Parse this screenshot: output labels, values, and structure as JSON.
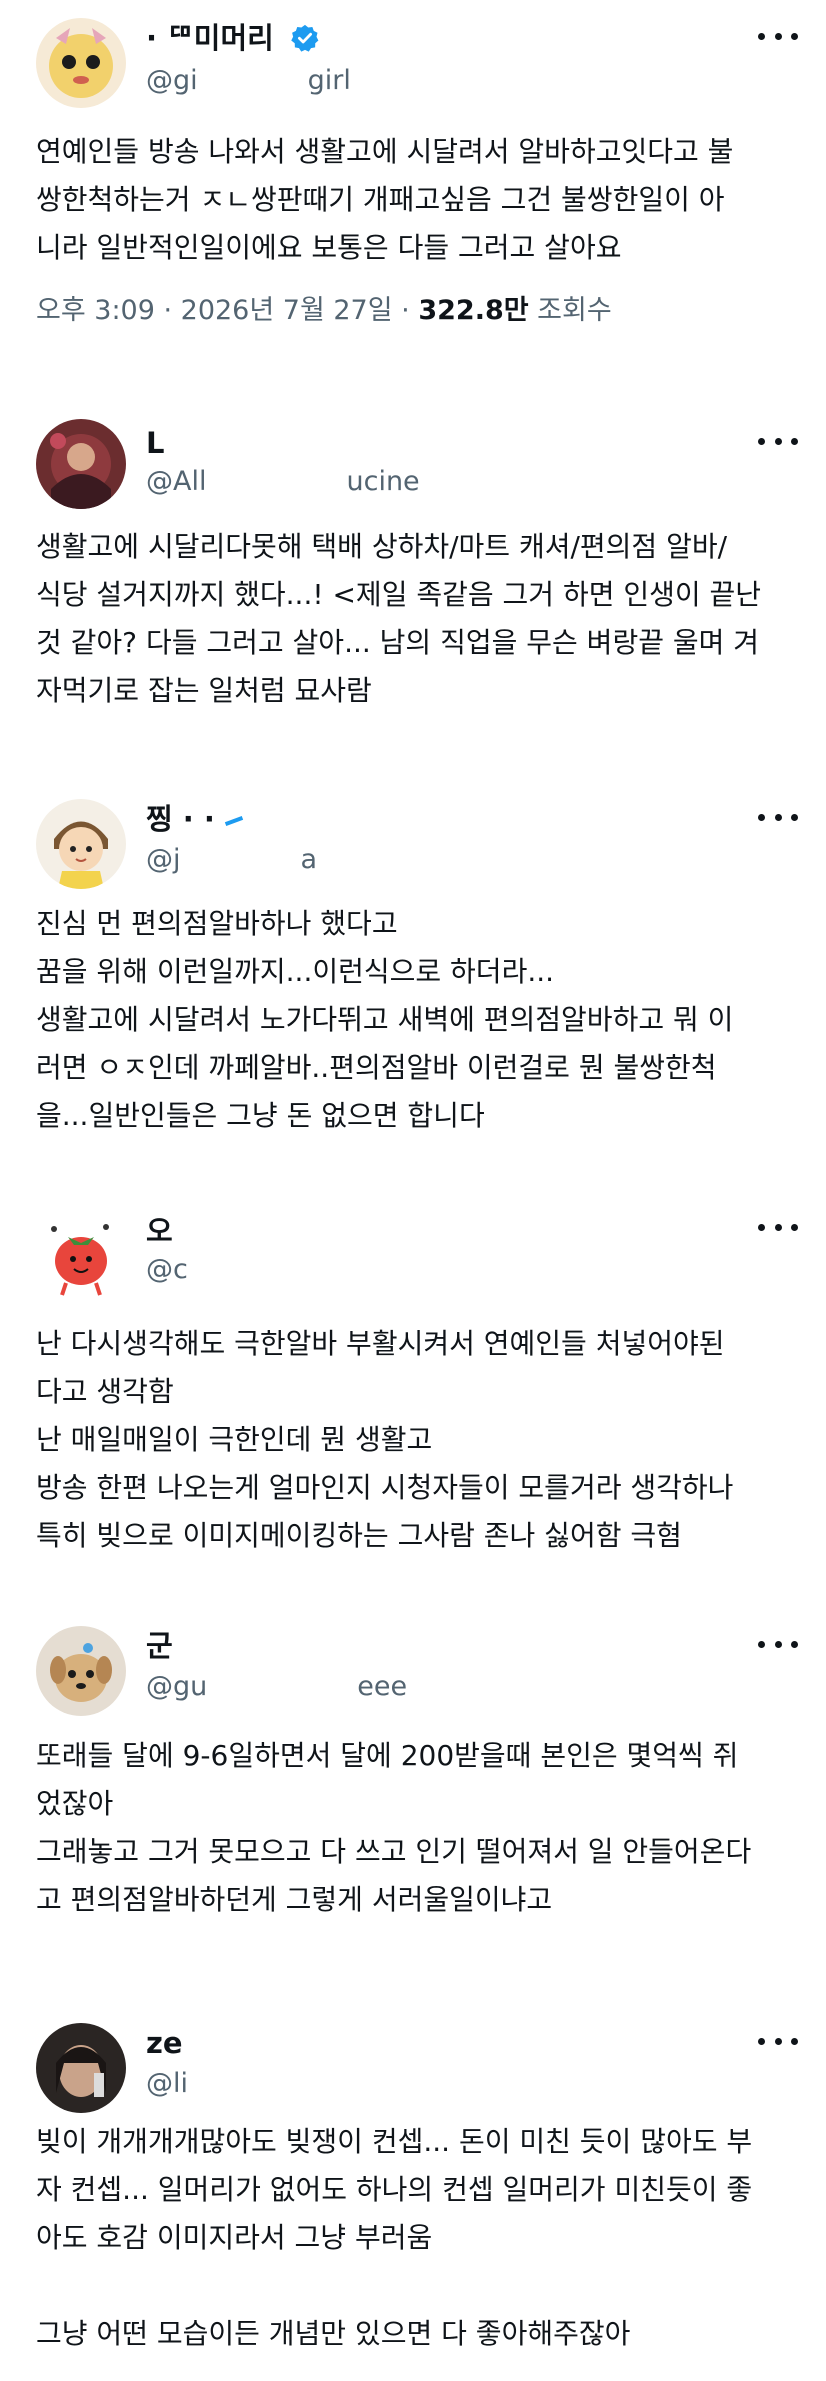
{
  "posts": [
    {
      "name": "· ᄃᄆ미머리",
      "handle_start": "@gi",
      "handle_end": "girl",
      "text": "연예인들 방송 나와서 생활고에 시달려서 알바하고잇다고 불\n쌍한척하는거 ㅈㄴ쌍판때기 개패고싶음 그건 불쌍한일이 아\n니라 일반적인일이에요 보통은 다들 그러고 살아요",
      "time": "오후 3:09 · 2026년 7월 27일 · ",
      "views": "322.8만",
      "views_label": " 조회수",
      "verified": true
    },
    {
      "name": "L",
      "handle_start": "@All",
      "handle_end": "ucine",
      "text": "생활고에 시달리다못해 택배 상하차/마트 캐셔/편의점 알바/\n식당 설거지까지 했다...! <제일 족같음 그거 하면 인생이 끝난\n것 같아? 다들 그러고 살아... 남의 직업을 무슨 벼랑끝 울며 겨\n자먹기로 잡는 일처럼 묘사람"
    },
    {
      "name": "찡 · ·",
      "handle_start": "@j",
      "handle_end": "a",
      "text": "진심 먼 편의점알바하나 했다고\n꿈을 위해 이런일까지...이런식으로 하더라...\n생활고에 시달려서 노가다뛰고 새벽에 편의점알바하고 뭐 이\n러면 ㅇㅈ인데 까페알바..편의점알바 이런걸로 뭔 불쌍한척\n을...일반인들은 그냥 돈 없으면 합니다"
    },
    {
      "name": "오",
      "handle_start": "@c",
      "handle_end": "",
      "text": "난 다시생각해도 극한알바 부활시켜서 연예인들 처넣어야된\n다고 생각함\n난 매일매일이 극한인데 뭔 생활고\n방송 한편 나오는게 얼마인지 시청자들이 모를거라 생각하나\n특히 빚으로 이미지메이킹하는 그사람 존나 싫어함 극혐"
    },
    {
      "name": "군",
      "handle_start": "@gu",
      "handle_end": "eee",
      "text": "또래들 달에 9-6일하면서 달에 200받을때 본인은 몇억씩 쥐\n었잖아\n그래놓고 그거 못모으고 다 쓰고 인기 떨어져서 일 안들어온다\n고 편의점알바하던게 그렇게 서러울일이냐고"
    },
    {
      "name": "ze",
      "handle_start": "@li",
      "handle_end": "",
      "text": "빚이 개개개개많아도 빚쟁이 컨셉... 돈이 미친 듯이 많아도 부\n자 컨셉... 일머리가 없어도 하나의 컨셉 일머리가 미친듯이 좋\n아도 호감 이미지라서 그냥 부러움\n\n그냥 어떤 모습이든 개념만 있으면 다 좋아해주잖아"
    }
  ],
  "icons": [
    "avatar",
    "verified-badge-icon",
    "more-options-icon"
  ],
  "colors": {
    "text": "#0f1419",
    "secondary": "#536471",
    "verified": "#1d9bf0"
  }
}
